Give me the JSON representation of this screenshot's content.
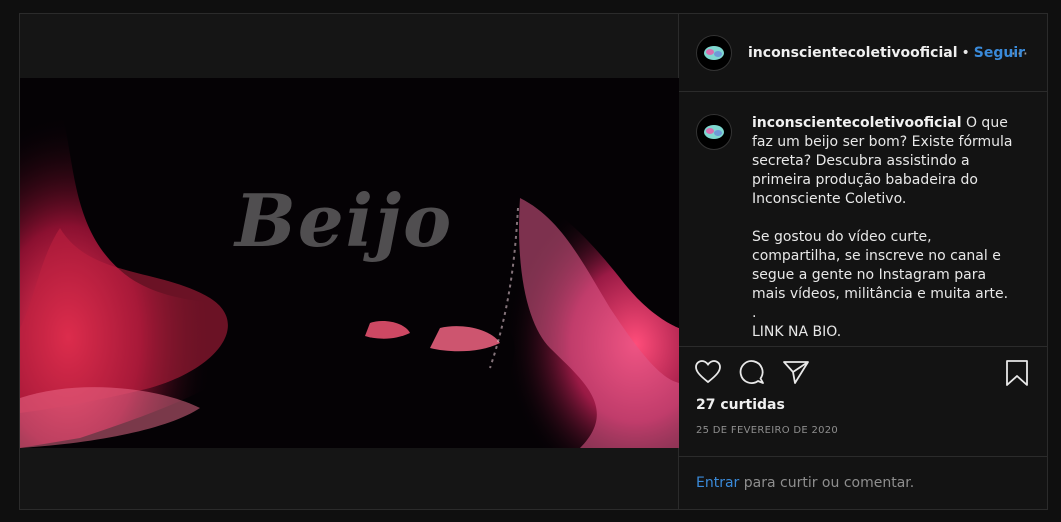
{
  "post": {
    "username": "inconscientecoletivooficial",
    "separator": "•",
    "follow_label": "Seguir",
    "more_label": "···",
    "image_title": "Beijo"
  },
  "caption": {
    "username": "inconscientecoletivooficial",
    "text": " O que faz um beijo ser bom? Existe fórmula secreta? Descubra assistindo a primeira produção babadeira do Inconsciente Coletivo.\n\nSe gostou do vídeo curte, compartilha, se inscreve no canal e segue a gente no Instagram para mais vídeos, militância e muita arte.\n.\nLINK NA BIO."
  },
  "actions": {
    "like_icon": "heart-icon",
    "comment_icon": "comment-icon",
    "share_icon": "paper-plane-icon",
    "save_icon": "bookmark-icon"
  },
  "stats": {
    "likes": "27 curtidas",
    "date": "25 DE FEVEREIRO DE 2020"
  },
  "comment": {
    "login_label": "Entrar",
    "rest": " para curtir ou comentar."
  },
  "colors": {
    "accent": "#3a8ad9",
    "background": "#151515",
    "border": "#2b2b2b"
  }
}
